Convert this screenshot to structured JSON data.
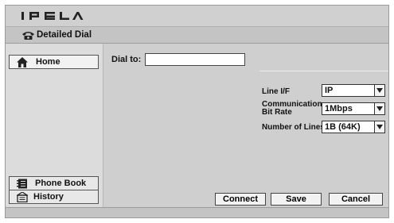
{
  "app": {
    "logo_text": "IPELA",
    "title": "Detailed Dial"
  },
  "sidebar": {
    "home_label": "Home",
    "phonebook_label": "Phone Book",
    "history_label": "History"
  },
  "dial": {
    "label": "Dial to:",
    "value": ""
  },
  "settings": {
    "line_if": {
      "label": "Line I/F",
      "value": "IP"
    },
    "bit_rate": {
      "label_line1": "Communication",
      "label_line2": "Bit Rate",
      "value": "1Mbps"
    },
    "num_lines": {
      "label": "Number of Lines",
      "value": "1B (64K)"
    }
  },
  "actions": {
    "connect": "Connect",
    "save": "Save",
    "cancel": "Cancel"
  },
  "icons": [
    "phone-icon",
    "home-icon",
    "phone-book-icon",
    "history-icon",
    "dropdown-arrow-icon"
  ]
}
